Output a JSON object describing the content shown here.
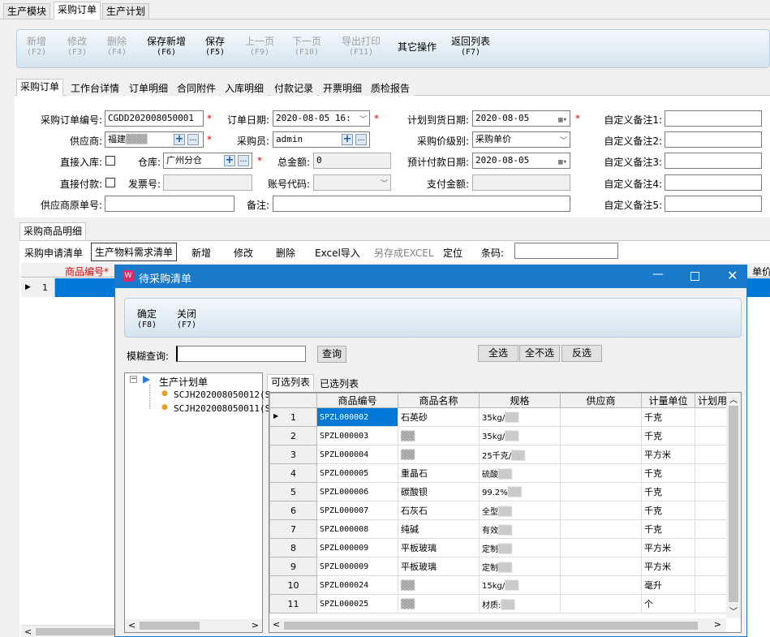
{
  "top_tabs": [
    "生产模块",
    "采购订单",
    "生产计划"
  ],
  "toolbar": [
    {
      "label": "新增",
      "key": "(F2)",
      "disabled": true
    },
    {
      "label": "修改",
      "key": "(F3)",
      "disabled": true
    },
    {
      "label": "删除",
      "key": "(F4)",
      "disabled": true
    },
    {
      "label": "保存新增",
      "key": "(F6)",
      "disabled": false
    },
    {
      "label": "保存",
      "key": "(F5)",
      "disabled": false
    },
    {
      "label": "上一页",
      "key": "(F9)",
      "disabled": true
    },
    {
      "label": "下一页",
      "key": "(F10)",
      "disabled": true
    },
    {
      "label": "导出打印",
      "key": "(F11)",
      "disabled": true
    },
    {
      "label": "其它操作",
      "key": "",
      "disabled": false
    },
    {
      "label": "返回列表",
      "key": "(F7)",
      "disabled": false
    }
  ],
  "sub_tabs": [
    "采购订单",
    "工作台详情",
    "订单明细",
    "合同附件",
    "入库明细",
    "付款记录",
    "开票明细",
    "质检报告"
  ],
  "form": {
    "order_no_label": "采购订单编号:",
    "order_no": "CGDD202008050001",
    "order_date_label": "订单日期:",
    "order_date": "2020-08-05 16:",
    "plan_date_label": "计划到货日期:",
    "plan_date": "2020-08-05",
    "remark1_label": "自定义备注1:",
    "supplier_label": "供应商:",
    "supplier": "福建",
    "buyer_label": "采购员:",
    "buyer": "admin",
    "price_level_label": "采购价级别:",
    "price_level": "采购单价",
    "remark2_label": "自定义备注2:",
    "direct_in_label": "直接入库:",
    "warehouse_label": "仓库:",
    "warehouse": "广州分仓",
    "total_label": "总金额:",
    "total": "0",
    "pay_date_label": "预计付款日期:",
    "pay_date": "2020-08-05",
    "remark3_label": "自定义备注3:",
    "direct_pay_label": "直接付款:",
    "invoice_label": "发票号:",
    "account_label": "账号代码:",
    "pay_amount_label": "支付金额:",
    "remark4_label": "自定义备注4:",
    "supplier_no_label": "供应商原单号:",
    "note_label": "备注:",
    "remark5_label": "自定义备注5:"
  },
  "detail": {
    "tab": "采购商品明细",
    "buttons": [
      "采购申请清单",
      "生产物料需求清单",
      "新增",
      "修改",
      "删除",
      "Excel导入",
      "另存成EXCEL",
      "定位",
      "条码:"
    ],
    "col_code": "商品编号*",
    "col_price": "单价",
    "row1": "1"
  },
  "dialog": {
    "title": "待采购清单",
    "confirm": "确定",
    "confirm_key": "(F8)",
    "close": "关闭",
    "close_key": "(F7)",
    "search_label": "模糊查询:",
    "search_btn": "查询",
    "select_all": "全选",
    "select_none": "全不选",
    "invert": "反选",
    "tree_root": "生产计划单",
    "tree_items": [
      "SCJH202008050012(S",
      "SCJH202008050011(S"
    ],
    "tabs": [
      "可选列表",
      "已选列表"
    ],
    "columns": [
      "商品编号",
      "商品名称",
      "规格",
      "供应商",
      "计量单位",
      "计划用"
    ],
    "rows": [
      {
        "no": "1",
        "code": "SPZL000002",
        "name": "石英砂",
        "spec": "35kg/",
        "unit": "千克"
      },
      {
        "no": "2",
        "code": "SPZL000003",
        "name": "",
        "spec": "35kg/",
        "unit": "千克"
      },
      {
        "no": "3",
        "code": "SPZL000004",
        "name": "",
        "spec": "25千克/",
        "unit": "平方米"
      },
      {
        "no": "4",
        "code": "SPZL000005",
        "name": "重晶石",
        "spec": "硫酸",
        "unit": "千克"
      },
      {
        "no": "5",
        "code": "SPZL000006",
        "name": "碳酸钡",
        "spec": "99.2%",
        "unit": "千克"
      },
      {
        "no": "6",
        "code": "SPZL000007",
        "name": "石灰石",
        "spec": "全型",
        "unit": "千克"
      },
      {
        "no": "7",
        "code": "SPZL000008",
        "name": "纯碱",
        "spec": "有效",
        "unit": "千克"
      },
      {
        "no": "8",
        "code": "SPZL000009",
        "name": "平板玻璃",
        "spec": "定制",
        "unit": "平方米"
      },
      {
        "no": "9",
        "code": "SPZL000009",
        "name": "平板玻璃",
        "spec": "定制",
        "unit": "平方米"
      },
      {
        "no": "10",
        "code": "SPZL000024",
        "name": "",
        "spec": "15kg/",
        "unit": "毫升"
      },
      {
        "no": "11",
        "code": "SPZL000025",
        "name": "",
        "spec": "材质:",
        "unit": "个"
      }
    ]
  }
}
